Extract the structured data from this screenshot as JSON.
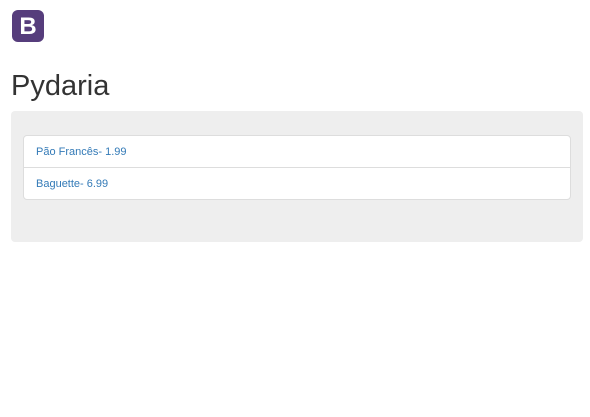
{
  "brand": {
    "logo_letter": "B",
    "logo_color": "#563d7c"
  },
  "header": {
    "title": "Pydaria"
  },
  "products": [
    {
      "label": "Pão Francês- 1.99"
    },
    {
      "label": "Baguette- 6.99"
    }
  ],
  "colors": {
    "link": "#337ab7",
    "well_background": "#eeeeee",
    "border": "#dddddd"
  }
}
